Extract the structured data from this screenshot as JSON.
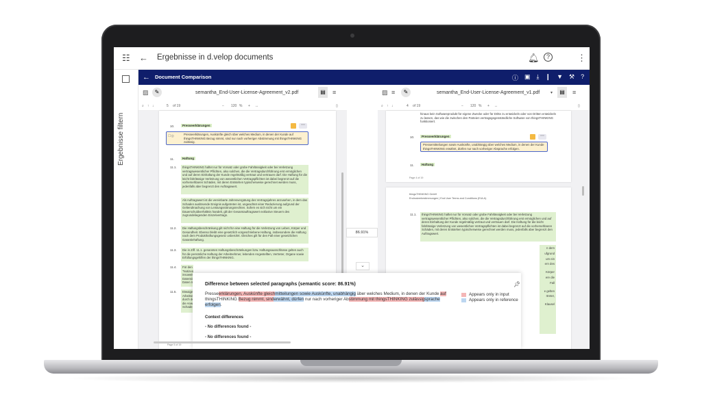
{
  "app": {
    "title": "Ergebnisse in d.velop documents",
    "sidebar_label": "Ergebnisse filtern"
  },
  "toolbar": {
    "title": "Document Comparison"
  },
  "left_pane": {
    "filename": "semantha_End-User-License-Agreement_v2.pdf",
    "page_indicator": "5",
    "page_total": "of 19",
    "zoom": "120",
    "zoom_unit": "%",
    "sections": [
      {
        "num": "10.",
        "heading": "Presseerklärungen"
      },
      {
        "num": "11.",
        "heading": "Haftung"
      }
    ],
    "selected_paragraph": "Presseerklärungen, Auskünfte gleich über welches Medium, in denen der Kunde auf thingsTHINKING Bezug nimmt, sind nur nach vorheriger Abstimmung mit thingsTHINKING zulässig.",
    "paragraphs": [
      {
        "num": "11.1.",
        "text": "thingsTHINKING haftet nur für Vorsatz oder grobe Fahrlässigkeit oder bei Verletzung vertragswesentlicher Pflichten, also solchen, die die Vertragsdurchführung erst ermöglichen und auf deren Einhaltung der Kunde regelmäßig vertraut und vertrauen darf. Die Haftung für die leicht fahrlässige Verletzung von wesentlichen Vertragspflichten ist dabei begrenzt auf die vorhersehbaren Schäden, mit deren Entstehen typischerweise gerechnet werden muss, jedenfalls aber begrenzt den Auftragswert."
      },
      {
        "num": "",
        "text": "Als Auftragswert ist die vereinbarte Jahresvergütung des Vertragsjahres anzusehen, in dem das Schaden auslösende Ereignis aufgetreten ist, ungeachtet einer Reduzierung aufgrund der Geltendmachung von Leistungsstörungsrechten. Sofern es sich nicht um ein Dauerschuldverhältnis handelt, gilt der Gesamtauftragswert exklusive Steuern des zugrundeliegenden Einzelvertrags."
      },
      {
        "num": "11.2.",
        "text": "Die Haftungsbeschränkung gilt nicht für eine Haftung für die Verletzung von Leben, Körper und Gesundheit. Ebenso bleibt eine gesetzlich vorgeschriebene Haftung, insbesondere die Haftung nach dem Produkthaftungsgesetz unberührt. Gleiches gilt für den Fall einer gesetzlichen Garantiehaftung."
      },
      {
        "num": "11.3.",
        "text": "Die in Ziff. 11.1. genannten Haftungsbeschränkungen bzw. Haftungsausschlüsse gelten auch für die persönliche Haftung der Arbeitnehmer, leitenden Angestellten, Vertreter, Organe sowie Erfüllungsgehilfen der thingsTHINKING."
      },
      {
        "num": "11.4.",
        "text": "Für den\n\"Notizen\ninsoweit\nDatensic\nDaten m"
      },
      {
        "num": "11.5.",
        "text": "Etwaige\nArbeitse\ndurch de\ndie Anw\nSchaden"
      }
    ],
    "page_footer": "Page 5 of 19"
  },
  "right_pane": {
    "filename": "semantha_End-User-License-Agreement_v1.pdf",
    "page_indicator": "4",
    "page_total": "of 19",
    "zoom": "120",
    "zoom_unit": "%",
    "top_text": "hinaus kein Softwareprodukt für eigene Zwecke oder für Dritte zu entwickeln oder von Dritten entwickeln zu lassen, das wie die zwischen den Parteien vertragsgegenständliche Software von thingsTHINKING funktioniert.",
    "sections": [
      {
        "num": "10.",
        "heading": "Presseerklärungen"
      },
      {
        "num": "11.",
        "heading": "Haftung"
      }
    ],
    "selected_paragraph": "Pressemitteilungen sowie Auskünfte, unabhängig über welches Medium, in denen der Kunde thingsTHINKING erwähnt, dürfen nur nach vorheriger Absprache erfolgen.",
    "page_footer": "Page 4 of 19",
    "page2_company": "thingsTHINKING GmbH",
    "page2_subtitle": "Endnutzerbestimmungen | End User Terms and Conditions (EULA)",
    "paragraphs": [
      {
        "num": "11.1.",
        "text": "thingsTHINKING haftet nur für Vorsatz oder grobe Fahrlässigkeit oder bei Verletzung vertragswesentlicher Pflichten, also solchen, die die Vertragsdurchführung erst ermöglichen und auf deren Einhaltung der Kunde regelmäßig vertraut und vertrauen darf. Die Haftung für die leicht fahrlässige Verletzung von wesentlichen Vertragspflichten ist dabei begrenzt auf die vorhersehbaren Schäden, mit deren Entstehen typischerweise gerechnet werden muss, jedenfalls aber begrenzt den Auftragswert."
      }
    ],
    "edge_fragments": [
      "n dem",
      "ufgrund",
      "um ein",
      "ern des",
      "Körper",
      "ere die",
      "Fall",
      "e gelten",
      "rtreter,",
      "Klausel"
    ]
  },
  "comparison": {
    "score": "86.91%"
  },
  "diff": {
    "title": "Difference between selected paragraphs (semantic score: 86.91%)",
    "segments": [
      {
        "text": "Presse",
        "type": "plain"
      },
      {
        "text": "erklärungen, Auskünfte gleich",
        "type": "input"
      },
      {
        "text": "mitteilungen sowie Auskünfte, unabhängig",
        "type": "reference"
      },
      {
        "text": " über welches Medium, in denen der Kunde ",
        "type": "plain"
      },
      {
        "text": "auf",
        "type": "input"
      },
      {
        "text": " thingsTHINKING ",
        "type": "plain"
      },
      {
        "text": "Bezug nimmt, sind",
        "type": "input"
      },
      {
        "text": "erwähnt, dürfen",
        "type": "reference"
      },
      {
        "text": " nur nach vorheriger Ab",
        "type": "plain"
      },
      {
        "text": "stimmung mit thingsTHINKING zulässig",
        "type": "input"
      },
      {
        "text": "sprache erfolgen",
        "type": "reference"
      },
      {
        "text": ".",
        "type": "plain"
      }
    ],
    "legend_input": "Appears only in input",
    "legend_reference": "Appears only in reference",
    "context_title": "Context differences",
    "no_diff_1": "- No differences found -",
    "no_diff_2": "- No differences found -"
  },
  "colors": {
    "toolbar_bg": "#0f1e6b",
    "input_highlight": "#f4b6b6",
    "reference_highlight": "#bcd6f0",
    "match_green": "#dff0cf",
    "flag_orange": "#f4b942",
    "selection_border": "#4a64c9"
  }
}
